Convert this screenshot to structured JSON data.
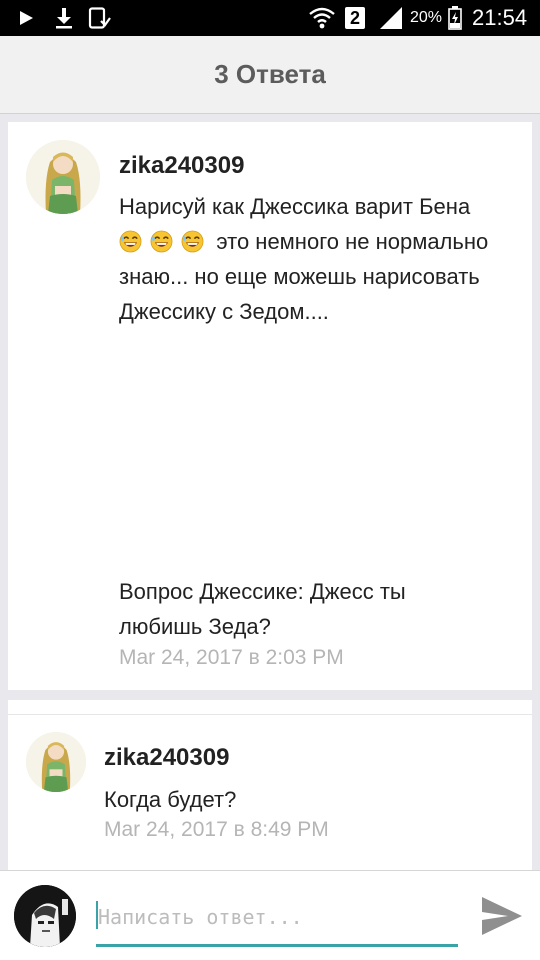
{
  "status_bar": {
    "sim": "2",
    "battery": "20%",
    "time": "21:54",
    "icons": [
      "play-icon",
      "download-icon",
      "screenshot-icon",
      "wifi-icon",
      "sim-icon",
      "signal-icon",
      "battery-icon"
    ]
  },
  "header": {
    "title": "3 Ответа"
  },
  "comments": [
    {
      "username": "zika240309",
      "line1": "Нарисуй как Джессика варит Бена",
      "line2": "это немного не нормально",
      "line3": "знаю... но еще можешь нарисовать",
      "line4": "Джессику с Зедом....",
      "line5": "Вопрос Джессике: Джесс ты",
      "line6": "любишь Зеда?",
      "timestamp": "Mar 24, 2017 в 2:03 PM",
      "emoji": "grinning-sweat-emoji",
      "emoji_count": 3
    },
    {
      "username": "zika240309",
      "text": "Когда будет?",
      "timestamp": "Mar 24, 2017 в 8:49 PM"
    }
  ],
  "reply": {
    "placeholder": "Написать ответ...",
    "value": ""
  },
  "colors": {
    "accent": "#3aa3a8",
    "header_bg": "#f1f1f1",
    "page_bg": "#e9e8ec",
    "meta_text": "#b5b5b5"
  }
}
